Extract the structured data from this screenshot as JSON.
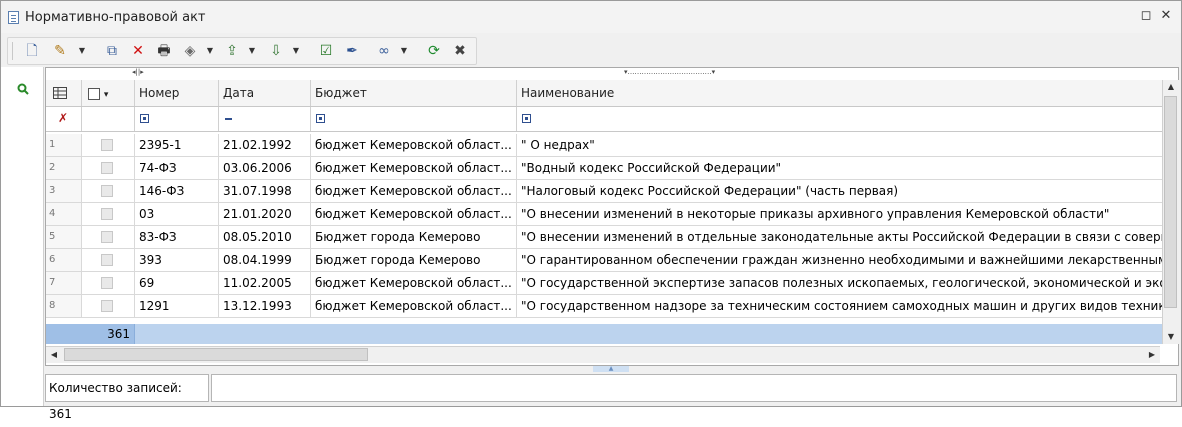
{
  "window": {
    "title": "Нормативно-правовой акт",
    "restore_glyph": "◻",
    "close_glyph": "✕"
  },
  "toolbar": {
    "items": [
      {
        "icon": "new-document-icon",
        "glyph": "🗋",
        "color": "#3b5f9a"
      },
      {
        "icon": "edit-document-icon",
        "glyph": "✎",
        "color": "#b07a1a"
      },
      {
        "icon": "copy-icon",
        "glyph": "⧉",
        "color": "#3b5f9a"
      },
      {
        "icon": "delete-icon",
        "glyph": "✕",
        "color": "#d01010"
      },
      {
        "icon": "print-icon",
        "glyph": "🖶",
        "color": "#333333"
      },
      {
        "icon": "eraser-icon",
        "glyph": "◈",
        "color": "#6a6a6a"
      },
      {
        "icon": "export-icon",
        "glyph": "⇪",
        "color": "#3a7a3a"
      },
      {
        "icon": "import-icon",
        "glyph": "⇩",
        "color": "#3a7a3a"
      },
      {
        "icon": "check-document-icon",
        "glyph": "☑",
        "color": "#2a7a2a"
      },
      {
        "icon": "highlighter-icon",
        "glyph": "✒",
        "color": "#2a4f8f"
      },
      {
        "icon": "link-icon",
        "glyph": "∞",
        "color": "#3b5f9a"
      },
      {
        "icon": "refresh-icon",
        "glyph": "⟳",
        "color": "#1e8a2e"
      },
      {
        "icon": "settings-tools-icon",
        "glyph": "✖",
        "color": "#444444"
      }
    ],
    "dropdown_glyph": "▼"
  },
  "grid": {
    "columns": [
      {
        "key": "settings",
        "label": ""
      },
      {
        "key": "check",
        "label": "▾"
      },
      {
        "key": "number",
        "label": "Номер"
      },
      {
        "key": "date",
        "label": "Дата"
      },
      {
        "key": "budget",
        "label": "Бюджет"
      },
      {
        "key": "name",
        "label": "Наименование"
      }
    ],
    "rows": [
      {
        "n": "1",
        "number": "2395-1",
        "date": "21.02.1992",
        "budget": "бюджет Кемеровской област...",
        "name": "\" О недрах\""
      },
      {
        "n": "2",
        "number": "74-ФЗ",
        "date": "03.06.2006",
        "budget": "бюджет Кемеровской област...",
        "name": "\"Водный кодекс Российской Федерации\""
      },
      {
        "n": "3",
        "number": "146-ФЗ",
        "date": "31.07.1998",
        "budget": "бюджет Кемеровской област...",
        "name": "\"Налоговый кодекс Российской Федерации\" (часть первая)"
      },
      {
        "n": "4",
        "number": "03",
        "date": "21.01.2020",
        "budget": "бюджет Кемеровской област...",
        "name": "\"О внесении изменений в некоторые приказы архивного управления Кемеровской области\""
      },
      {
        "n": "5",
        "number": "83-ФЗ",
        "date": "08.05.2010",
        "budget": "Бюджет города Кемерово",
        "name": "\"О внесении изменений в отдельные законодательные акты Российской Федерации в связи с совершенствова"
      },
      {
        "n": "6",
        "number": "393",
        "date": "08.04.1999",
        "budget": "Бюджет города Кемерово",
        "name": "\"О гарантированном обеспечении граждан жизненно необходимыми и важнейшими лекарственными средствами\""
      },
      {
        "n": "7",
        "number": "69",
        "date": "11.02.2005",
        "budget": "бюджет Кемеровской област...",
        "name": "\"О государственной экспертизе запасов полезных ископаемых, геологической, экономической и экологической"
      },
      {
        "n": "8",
        "number": "1291",
        "date": "13.12.1993",
        "budget": "бюджет Кемеровской област...",
        "name": "\"О государственном надзоре за техническим состоянием самоходных машин и других видов техники в Росси"
      }
    ],
    "total": "361"
  },
  "status": {
    "records_label": "Количество записей: 361",
    "second": ""
  }
}
